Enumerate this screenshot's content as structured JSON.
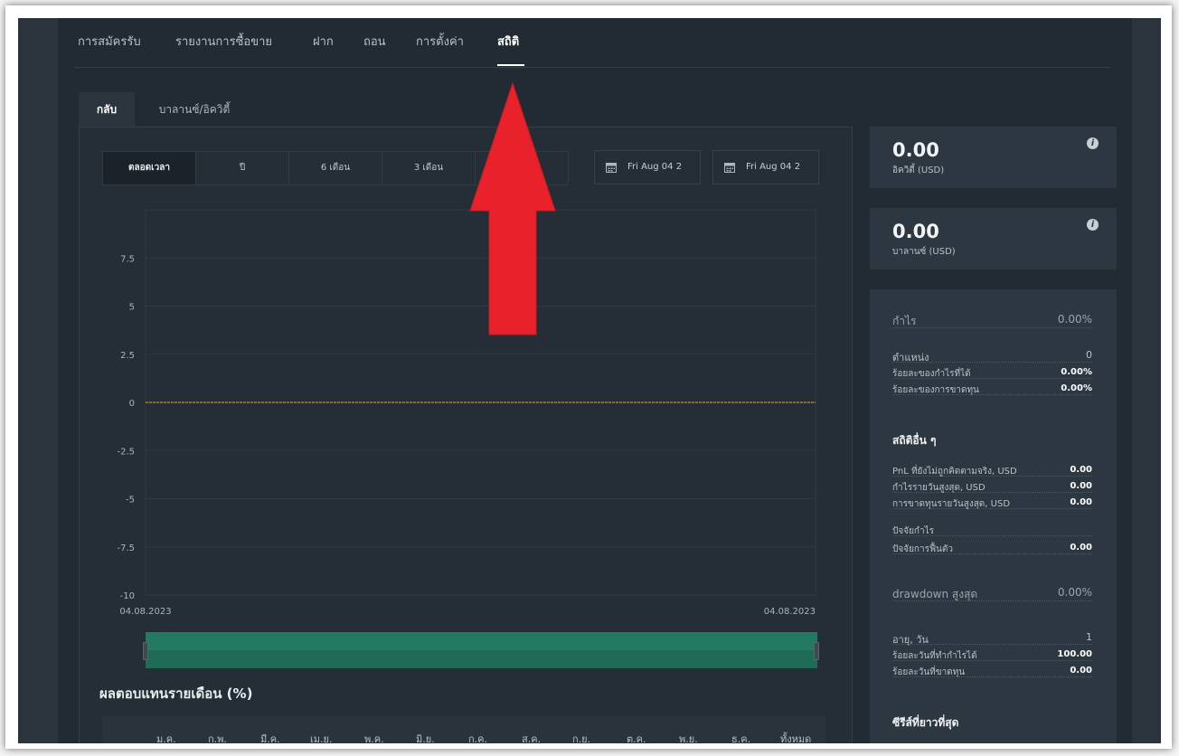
{
  "nav": {
    "items": [
      "การสมัครรับ",
      "รายงานการซื้อขาย",
      "ฝาก",
      "ถอน",
      "การตั้งค่า",
      "สถิติ"
    ],
    "active": "สถิติ"
  },
  "subtabs": {
    "back": "กลับ",
    "balance_equity": "บาลานซ์/อิควิตี้"
  },
  "range": {
    "options": [
      "ตลอดเวลา",
      "ปี",
      "6 เดือน",
      "3 เดือน",
      ""
    ],
    "selected": "ตลอดเวลา"
  },
  "date_range": {
    "from": "Fri Aug 04 2",
    "to": "Fri Aug 04 2"
  },
  "chart_data": {
    "type": "line",
    "y_ticks": [
      "7.5",
      "5",
      "2.5",
      "0",
      "-2.5",
      "-5",
      "-7.5",
      "-10"
    ],
    "ylim": [
      -10,
      10
    ],
    "x_labels": [
      "04.08.2023",
      "04.08.2023"
    ],
    "series": [
      {
        "values": [
          0,
          0
        ]
      }
    ],
    "grid": true
  },
  "monthly": {
    "title": "ผลตอบแทนรายเดือน (%)",
    "columns": [
      "ม.ค.",
      "ก.พ.",
      "มี.ค.",
      "เม.ย.",
      "พ.ค.",
      "มิ.ย.",
      "ก.ค.",
      "ส.ค.",
      "ก.ย.",
      "ต.ค.",
      "พ.ย.",
      "ธ.ค.",
      "ทั้งหมด"
    ]
  },
  "cards": {
    "equity": {
      "value": "0.00",
      "label": "อิควิตี้ (USD)"
    },
    "balance": {
      "value": "0.00",
      "label": "บาลานซ์ (USD)"
    }
  },
  "stats": {
    "profit": {
      "label": "กำไร",
      "value": "0.00%"
    },
    "positions": {
      "label": "ตำแหน่ง",
      "value": "0"
    },
    "profitable_pct": {
      "label": "ร้อยละของกำไรที่ได้",
      "value": "0.00%"
    },
    "loss_pct": {
      "label": "ร้อยละของการขาดทุน",
      "value": "0.00%"
    },
    "other_title": "สถิติอื่น ๆ",
    "unrealized_pnl": {
      "label": "PnL ที่ยังไม่ถูกคิดตามจริง, USD",
      "value": "0.00"
    },
    "max_daily_profit": {
      "label": "กำไรรายวันสูงสุด, USD",
      "value": "0.00"
    },
    "max_daily_loss": {
      "label": "การขาดทุนรายวันสูงสุด, USD",
      "value": "0.00"
    },
    "profit_factor": {
      "label": "ปัจจัยกำไร",
      "value": ""
    },
    "recovery_factor": {
      "label": "ปัจจัยการฟื้นตัว",
      "value": "0.00"
    },
    "max_drawdown": {
      "label": "drawdown สูงสุด",
      "value": "0.00%"
    },
    "age_days": {
      "label": "อายุ, วัน",
      "value": "1"
    },
    "profitable_days_pct": {
      "label": "ร้อยละวันที่ทำกำไรได้",
      "value": "100.00"
    },
    "losing_days_pct": {
      "label": "ร้อยละวันที่ขาดทุน",
      "value": "0.00"
    },
    "longest_series_title": "ซีรีส์ที่ยาวที่สุด"
  },
  "colors": {
    "background": "#222b33",
    "panel": "#252e37",
    "card": "#2d3741",
    "navigator": "#1f6b55",
    "zero_line": "#b5763f",
    "annotation_arrow": "#e8212b"
  }
}
